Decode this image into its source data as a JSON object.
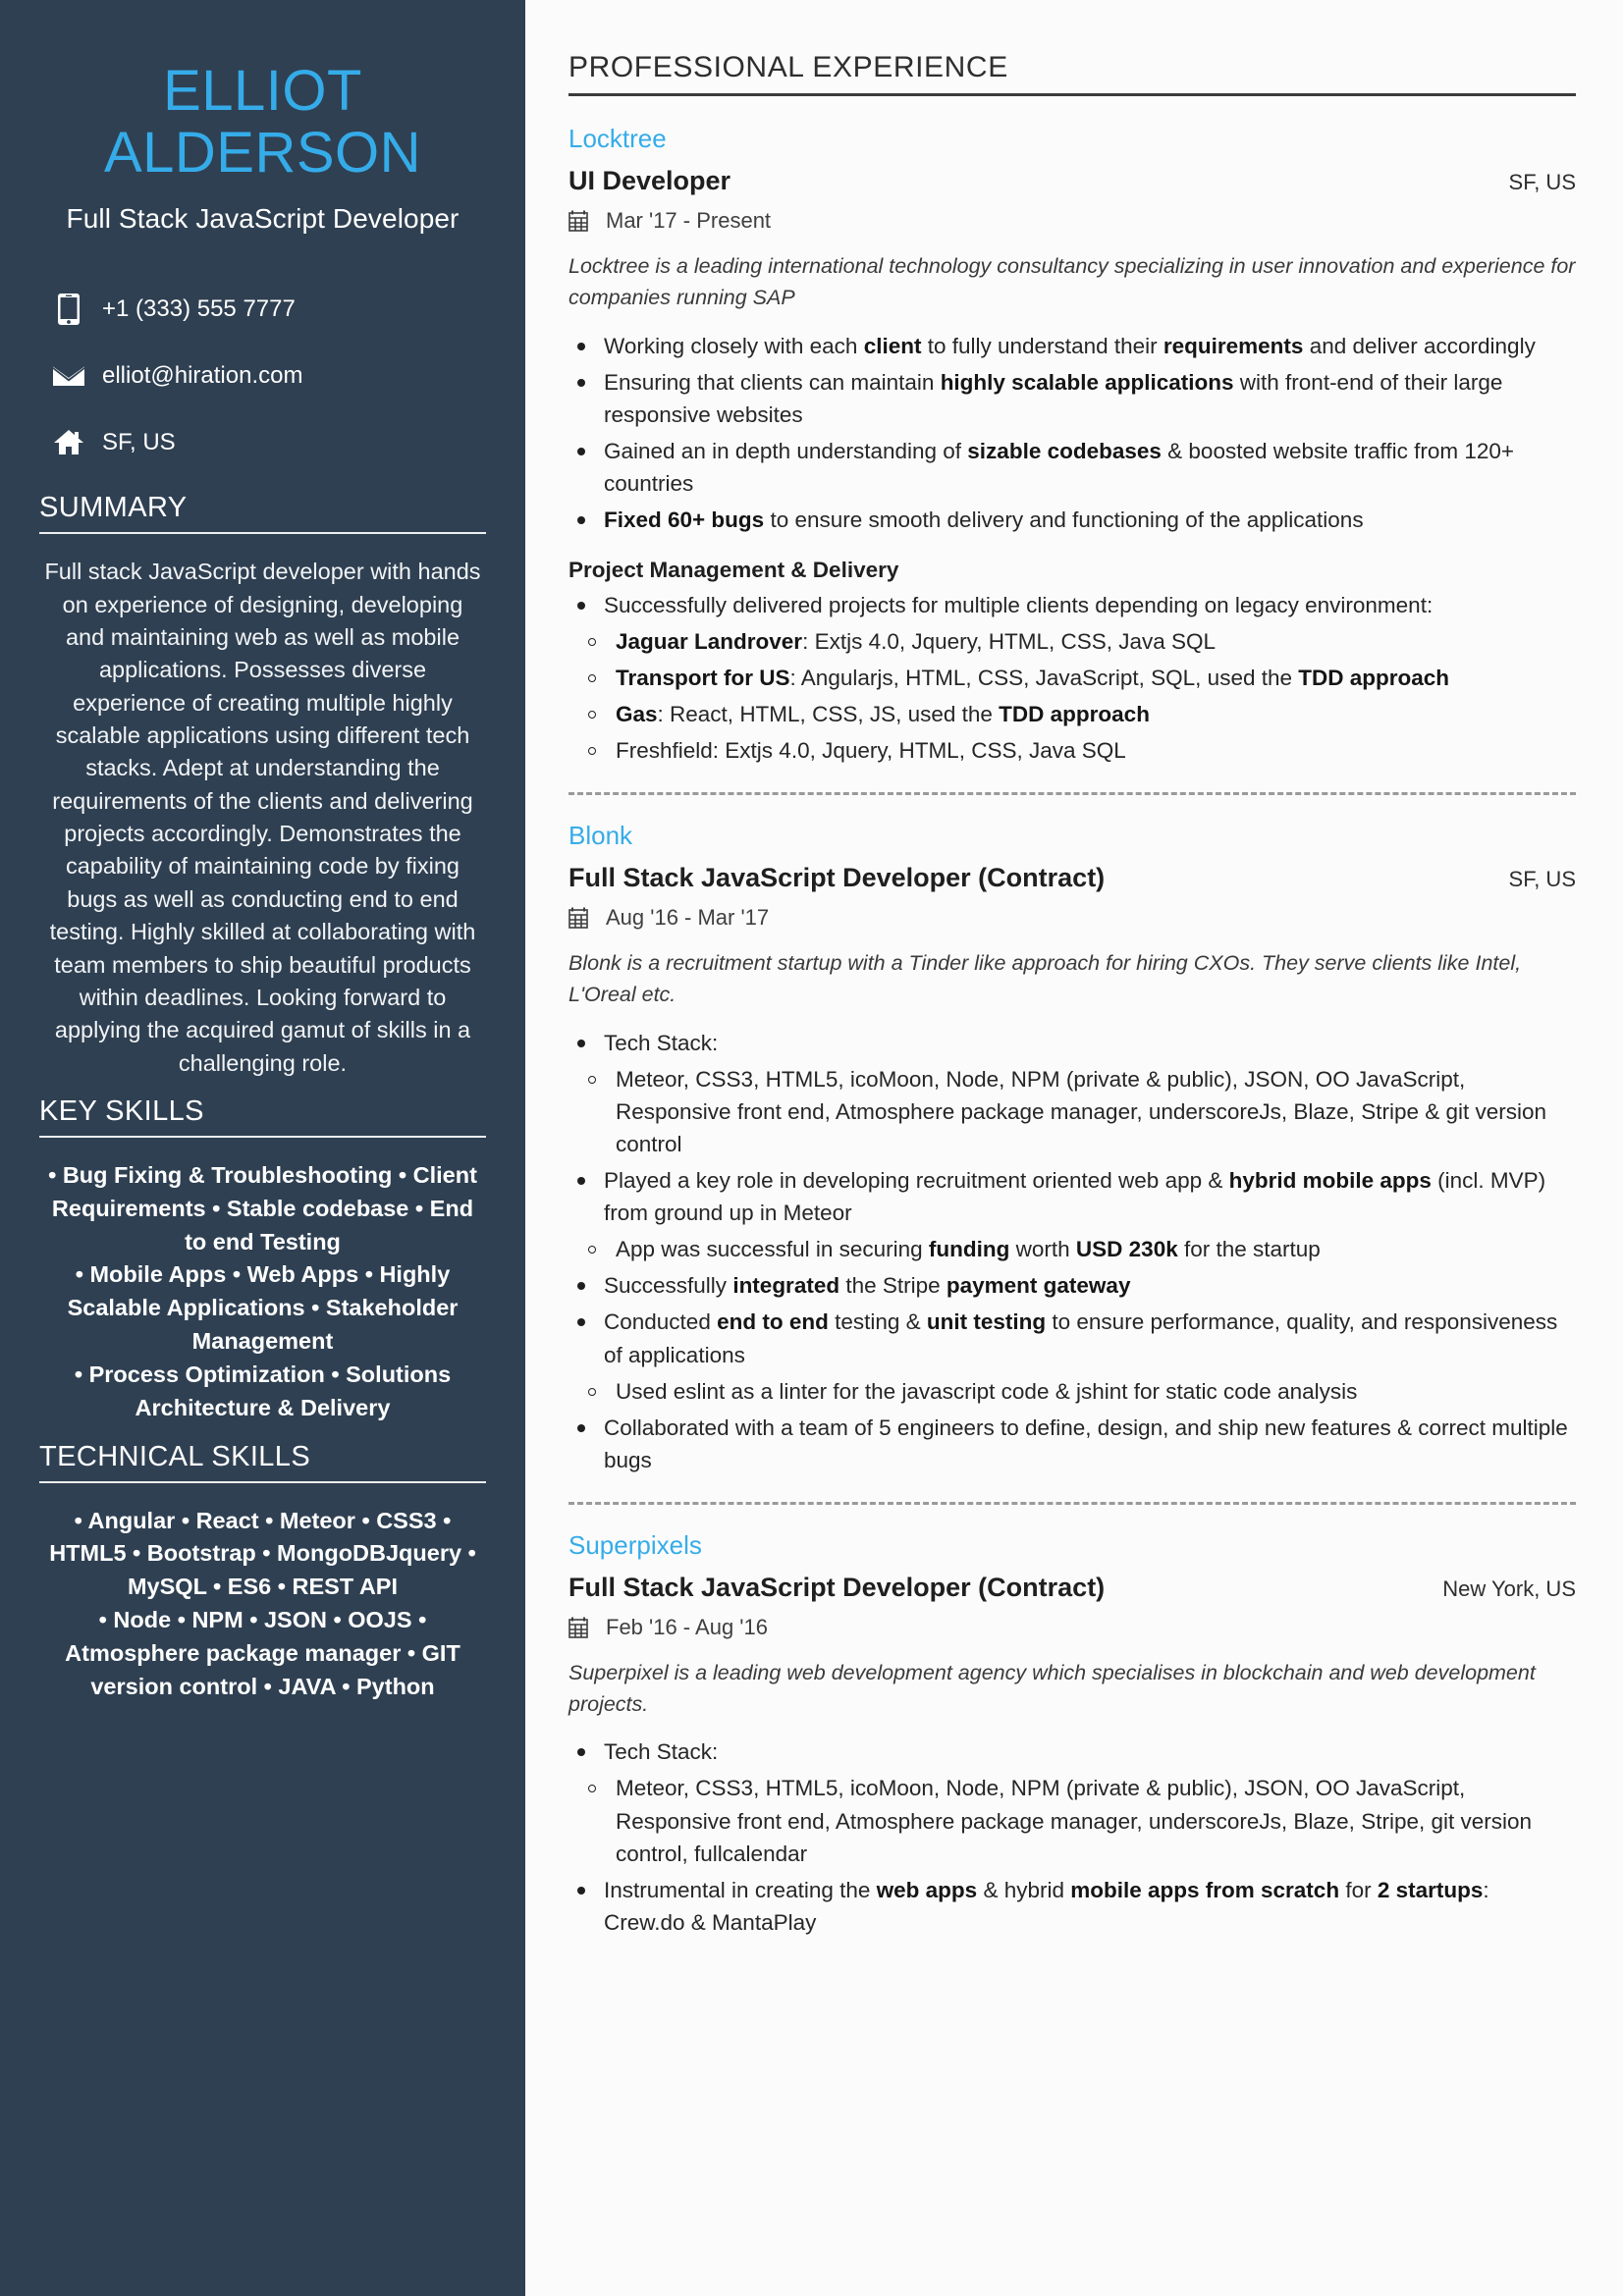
{
  "colors": {
    "sidebar_bg": "#2f4052",
    "accent_blue": "#35ace9",
    "main_bg": "#fbfbfb",
    "text_dark": "#262626"
  },
  "sidebar": {
    "name_first": "ELLIOT",
    "name_last": "ALDERSON",
    "job_title": "Full Stack JavaScript Developer",
    "contacts": [
      {
        "icon": "phone-icon",
        "value": "+1 (333) 555 7777"
      },
      {
        "icon": "email-icon",
        "value": "elliot@hiration.com"
      },
      {
        "icon": "home-icon",
        "value": "SF, US"
      }
    ],
    "summary": {
      "heading": "SUMMARY",
      "text": "Full stack JavaScript developer with hands on experience of designing, developing and maintaining web as well as mobile applications. Possesses diverse experience of creating multiple highly scalable applications using different tech stacks. Adept at understanding the requirements of the clients and delivering projects accordingly. Demonstrates the capability of maintaining code by fixing bugs as well as conducting end to end testing. Highly skilled at collaborating with team members to ship beautiful products within deadlines. Looking forward to applying the acquired gamut of skills in a challenging role."
    },
    "key_skills": {
      "heading": "KEY SKILLS",
      "lines": [
        "• Bug Fixing & Troubleshooting • Client Requirements • Stable codebase • End to end Testing",
        "• Mobile Apps • Web Apps • Highly Scalable Applications • Stakeholder Management",
        "• Process Optimization • Solutions Architecture & Delivery"
      ]
    },
    "technical_skills": {
      "heading": "TECHNICAL SKILLS",
      "lines": [
        "• Angular • React • Meteor • CSS3 • HTML5 • Bootstrap • MongoDBJquery • MySQL • ES6 • REST API",
        "• Node • NPM • JSON • OOJS • Atmosphere package manager • GIT version control • JAVA • Python"
      ]
    }
  },
  "main": {
    "heading": "PROFESSIONAL EXPERIENCE",
    "jobs": [
      {
        "company": "Locktree",
        "role": "UI Developer",
        "location": "SF, US",
        "dates": "Mar '17 -  Present",
        "blurb": "Locktree is a leading international technology consultancy specializing in user innovation and experience for companies running SAP",
        "bullets": [
          "Working closely with each <b>client</b> to fully understand their <b>requirements</b> and deliver accordingly",
          "Ensuring that clients can maintain <b>highly scalable applications</b> with front-end of their large responsive websites",
          "Gained an in depth understanding of <b>sizable codebases</b> &amp; boosted website traffic from 120+ countries",
          "<b>Fixed 60+ bugs</b> to ensure smooth delivery and functioning of the applications"
        ],
        "sub_heading": "Project Management & Delivery",
        "sub_bullets": [
          "Successfully delivered projects for multiple clients depending on legacy environment:"
        ],
        "sub_sub_bullets": [
          "<b>Jaguar Landrover</b>: Extjs 4.0, Jquery, HTML, CSS, Java SQL",
          "<b>Transport for US</b>: Angularjs, HTML, CSS, JavaScript, SQL, used the <b>TDD approach</b>",
          "<b>Gas</b>: React, HTML, CSS, JS, used the <b>TDD approach</b>",
          "Freshfield: Extjs 4.0, Jquery, HTML, CSS, Java SQL"
        ]
      },
      {
        "company": "Blonk",
        "role": "Full Stack JavaScript Developer (Contract)",
        "location": "SF, US",
        "dates": "Aug '16 -  Mar '17",
        "blurb": "Blonk is a recruitment startup with a Tinder like approach for hiring CXOs. They serve clients like Intel, L'Oreal etc.",
        "tech_stack_label": "Tech Stack:",
        "tech_stack_text": "Meteor, CSS3, HTML5, icoMoon, Node, NPM (private & public), JSON, OO JavaScript, Responsive front end, Atmosphere package manager, underscoreJs, Blaze, Stripe & git version control",
        "bullets": [
          "Played a key role in developing recruitment oriented web app &amp; <b>hybrid mobile apps</b> (incl. MVP) from ground up in Meteor"
        ],
        "nested_1": "App was successful in securing <b>funding</b> worth <b>USD 230k</b> for the startup",
        "bullets2": [
          "Successfully <b>integrated</b> the Stripe <b>payment gateway</b>",
          "Conducted <b>end to end</b> testing &amp; <b>unit testing</b> to ensure performance, quality, and responsiveness of applications"
        ],
        "nested_2": "Used eslint as a linter for the javascript code &amp; jshint for static code analysis",
        "bullets3": [
          "Collaborated with a team of 5 engineers to define, design, and ship new features &amp; correct multiple bugs"
        ]
      },
      {
        "company": "Superpixels",
        "role": "Full Stack JavaScript Developer (Contract)",
        "location": "New York, US",
        "dates": "Feb '16 -  Aug '16",
        "blurb": "Superpixel is a leading web development agency which specialises in blockchain and web development projects.",
        "tech_stack_label": "Tech Stack:",
        "tech_stack_text": "Meteor, CSS3, HTML5, icoMoon, Node, NPM (private & public), JSON, OO JavaScript, Responsive front end, Atmosphere package manager, underscoreJs, Blaze, Stripe, git version control, fullcalendar",
        "bullets": [
          "Instrumental in creating the <b>web apps</b> &amp; hybrid <b>mobile apps from scratch</b> for <b>2 startups</b>: Crew.do &amp; MantaPlay"
        ]
      }
    ]
  }
}
